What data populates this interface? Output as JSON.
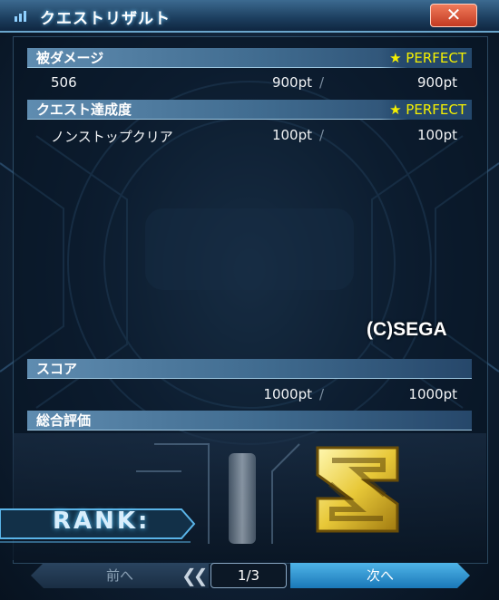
{
  "window": {
    "title": "クエストリザルト",
    "close_label": "✕"
  },
  "sections": {
    "damage": {
      "header": "被ダメージ",
      "rating": "★ PERFECT",
      "row": {
        "label": "506",
        "earned": "900pt",
        "slash": "/",
        "max": "900pt"
      }
    },
    "achievement": {
      "header": "クエスト達成度",
      "rating": "★ PERFECT",
      "row": {
        "label": "ノンストップクリア",
        "earned": "100pt",
        "slash": "/",
        "max": "100pt"
      }
    },
    "score": {
      "header": "スコア",
      "row": {
        "label": "",
        "earned": "1000pt",
        "slash": "/",
        "max": "1000pt"
      }
    },
    "overall": {
      "header": "総合評価",
      "rank_label": "RANK:",
      "rank": "S"
    }
  },
  "watermark": "(C)SEGA",
  "navigation": {
    "prev_label": "前へ",
    "page": "1/3",
    "next_label": "次へ"
  },
  "colors": {
    "perfect": "#f5f000",
    "rank_gold": "#e8c838",
    "next_button": "#1a78b8",
    "close_button": "#c23a22"
  }
}
